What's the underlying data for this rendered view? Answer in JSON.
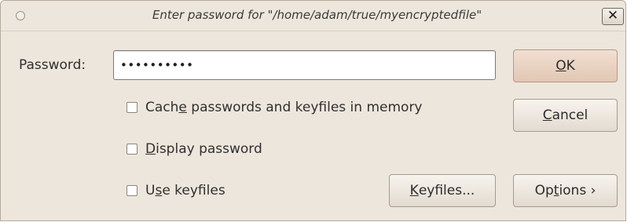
{
  "dialog": {
    "title": "Enter password for \"/home/adam/true/myencryptedfile\"",
    "close_glyph": "✕"
  },
  "password": {
    "label": "Password:",
    "masked_value": "••••••••••"
  },
  "options": {
    "cache": {
      "pre": "Cach",
      "mnemonic": "e",
      "post": " passwords and keyfiles in memory",
      "checked": false
    },
    "display": {
      "pre": "",
      "mnemonic": "D",
      "post": "isplay password",
      "checked": false
    },
    "keyfiles": {
      "pre": "U",
      "mnemonic": "s",
      "post": "e keyfiles",
      "checked": false
    }
  },
  "buttons": {
    "ok": {
      "pre": "",
      "mnemonic": "O",
      "post": "K"
    },
    "cancel": {
      "pre": "",
      "mnemonic": "C",
      "post": "ancel"
    },
    "keyfiles": {
      "pre": "",
      "mnemonic": "K",
      "post": "eyfiles..."
    },
    "options": {
      "pre": "Op",
      "mnemonic": "t",
      "post": "ions ›"
    }
  },
  "colors": {
    "window_bg": "#ede6dc",
    "default_button": "#e2c7b3"
  }
}
